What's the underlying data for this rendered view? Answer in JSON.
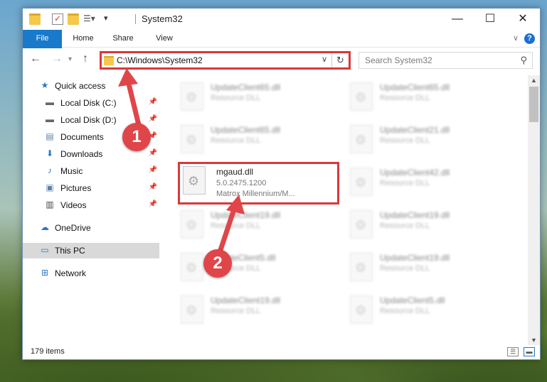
{
  "window": {
    "title": "System32",
    "controls": {
      "minimize": "—",
      "maximize": "☐",
      "close": "✕"
    }
  },
  "ribbon": {
    "tabs": [
      "File",
      "Home",
      "Share",
      "View"
    ],
    "help": "?"
  },
  "address": {
    "path": "C:\\Windows\\System32",
    "search_placeholder": "Search System32"
  },
  "nav": {
    "items": [
      {
        "label": "Quick access",
        "icon": "star-icon"
      },
      {
        "label": "Local Disk (C:)",
        "icon": "drive-icon"
      },
      {
        "label": "Local Disk (D:)",
        "icon": "drive-icon"
      },
      {
        "label": "Documents",
        "icon": "documents-icon"
      },
      {
        "label": "Downloads",
        "icon": "download-icon"
      },
      {
        "label": "Music",
        "icon": "music-icon"
      },
      {
        "label": "Pictures",
        "icon": "pictures-icon"
      },
      {
        "label": "Videos",
        "icon": "videos-icon"
      },
      {
        "label": "OneDrive",
        "icon": "cloud-icon"
      },
      {
        "label": "This PC",
        "icon": "computer-icon"
      },
      {
        "label": "Network",
        "icon": "network-icon"
      }
    ]
  },
  "files": {
    "left": [
      {
        "name": "UpdateClient65.dll",
        "desc": "Resource DLL"
      },
      {
        "name": "UpdateClient65.dll",
        "desc": "Resource DLL"
      },
      {
        "name": "mgaud.dll",
        "version": "5.0.2475.1200",
        "company": "Matrox Millennium/M..."
      },
      {
        "name": "UpdateClient19.dll",
        "desc": "Resource DLL"
      },
      {
        "name": "UpdateClient5.dll",
        "desc": "Resource DLL"
      },
      {
        "name": "UpdateClient19.dll",
        "desc": "Resource DLL"
      }
    ],
    "right": [
      {
        "name": "UpdateClient65.dll",
        "desc": "Resource DLL"
      },
      {
        "name": "UpdateClient21.dll",
        "desc": "Resource DLL"
      },
      {
        "name": "UpdateClient42.dll",
        "desc": "Resource DLL"
      },
      {
        "name": "UpdateClient19.dll",
        "desc": "Resource DLL"
      },
      {
        "name": "UpdateClient19.dll",
        "desc": "Resource DLL"
      },
      {
        "name": "UpdateClient5.dll",
        "desc": "Resource DLL"
      }
    ]
  },
  "status": {
    "count": "179 items"
  },
  "annotations": {
    "step1": "1",
    "step2": "2"
  },
  "colors": {
    "highlight": "#d9383a",
    "marker": "#e0454a",
    "accent": "#1979ca"
  }
}
